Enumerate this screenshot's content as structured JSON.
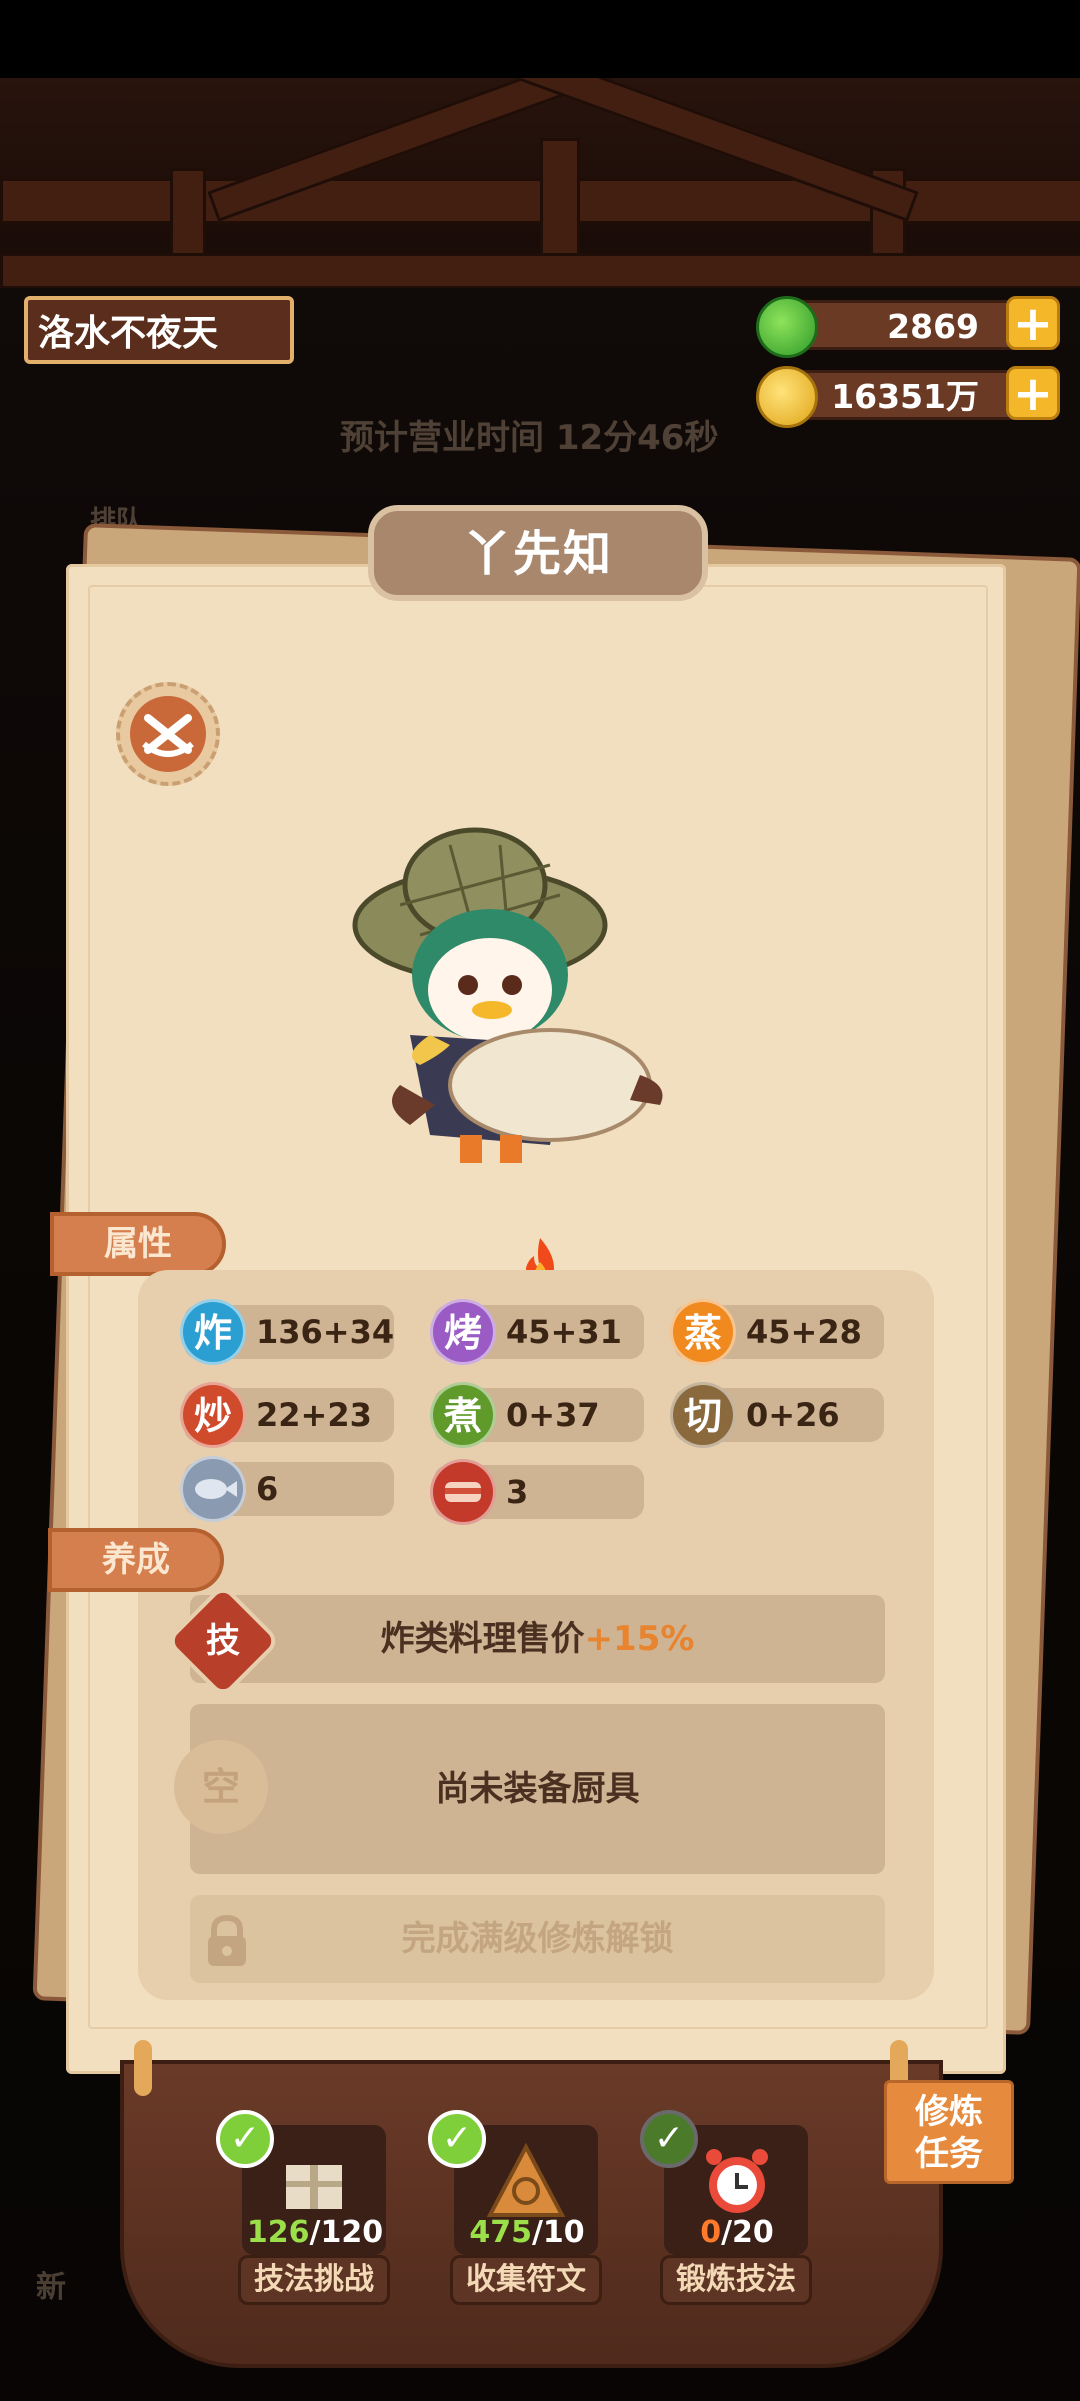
{
  "shop": {
    "name": "洛水不夜天",
    "business_time": "预计营业时间 12分46秒",
    "queue_label": "排队"
  },
  "currency": {
    "jade": "2869",
    "coins": "16351万"
  },
  "panel": {
    "title": "丫先知"
  },
  "tabs": {
    "attributes": "属性",
    "cultivate": "养成"
  },
  "stats": [
    {
      "icon": "炸",
      "value": "136+34",
      "color": "#2b9fd2"
    },
    {
      "icon": "烤",
      "value": "45+31",
      "color": "#9a5bc4"
    },
    {
      "icon": "蒸",
      "value": "45+28",
      "color": "#f0891e"
    },
    {
      "icon": "炒",
      "value": "22+23",
      "color": "#d04a2c"
    },
    {
      "icon": "煮",
      "value": "0+37",
      "color": "#5f9a2b"
    },
    {
      "icon": "切",
      "value": "0+26",
      "color": "#8a6a3c"
    },
    {
      "icon": "",
      "value": "6",
      "color": "#8a9ab0"
    },
    {
      "icon": "",
      "value": "3",
      "color": "#c43a2a"
    }
  ],
  "cultivate": {
    "skill_icon": "技",
    "skill_text": "炸类料理售价",
    "skill_bonus": "+15%",
    "tool_icon": "空",
    "tool_text": "尚未装备厨具",
    "locked_text": "完成满级修炼解锁"
  },
  "activities": [
    {
      "current": "126",
      "total": "/120",
      "label": "技法挑战",
      "current_color": "#9be04a"
    },
    {
      "current": "475",
      "total": "/10",
      "label": "收集符文",
      "current_color": "#9be04a"
    },
    {
      "current": "0",
      "total": "/20",
      "label": "锻炼技法",
      "current_color": "#ff7a2a"
    }
  ],
  "task_flag": {
    "line1": "修炼",
    "line2": "任务"
  },
  "bottom": {
    "new_label": "新"
  }
}
